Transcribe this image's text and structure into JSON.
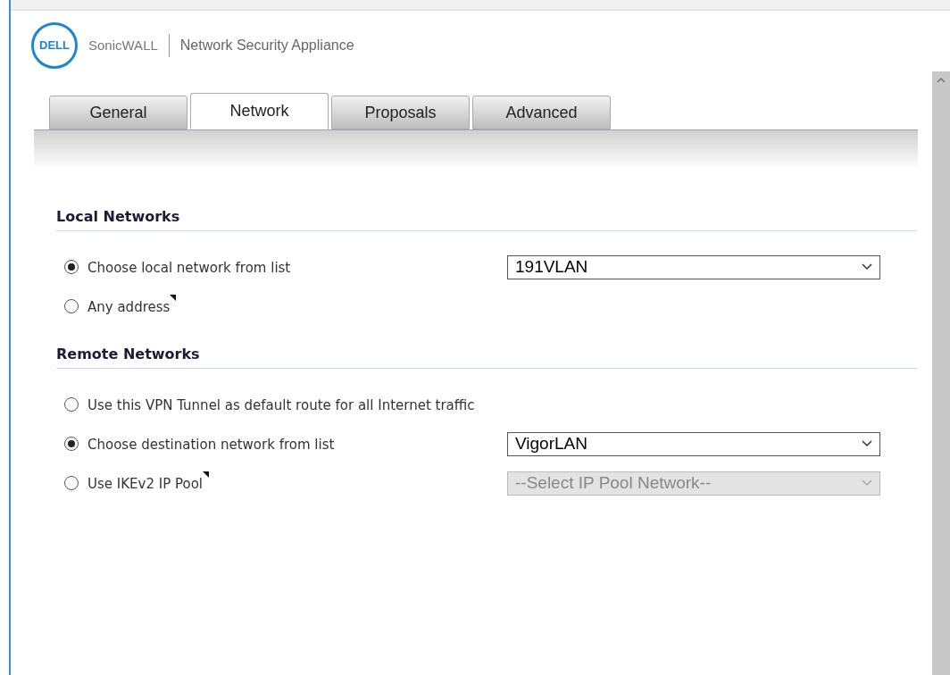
{
  "header": {
    "logo_text": "DELL",
    "brand": "SonicWALL",
    "product": "Network Security Appliance"
  },
  "tabs": [
    {
      "label": "General",
      "selected": false
    },
    {
      "label": "Network",
      "selected": true
    },
    {
      "label": "Proposals",
      "selected": false
    },
    {
      "label": "Advanced",
      "selected": false
    }
  ],
  "sections": [
    {
      "title": "Local Networks",
      "options": [
        {
          "label": "Choose local network from list",
          "selected": true,
          "tip": false,
          "select": {
            "value": "191VLAN",
            "disabled": false
          }
        },
        {
          "label": "Any address",
          "selected": false,
          "tip": true
        }
      ]
    },
    {
      "title": "Remote Networks",
      "options": [
        {
          "label": "Use this VPN Tunnel as default route for all Internet traffic",
          "selected": false,
          "tip": false
        },
        {
          "label": "Choose destination network from list",
          "selected": true,
          "tip": false,
          "select": {
            "value": "VigorLAN",
            "disabled": false
          }
        },
        {
          "label": "Use IKEv2 IP Pool",
          "selected": false,
          "tip": true,
          "select": {
            "placeholder": "--Select IP Pool Network--",
            "disabled": true
          }
        }
      ]
    }
  ]
}
